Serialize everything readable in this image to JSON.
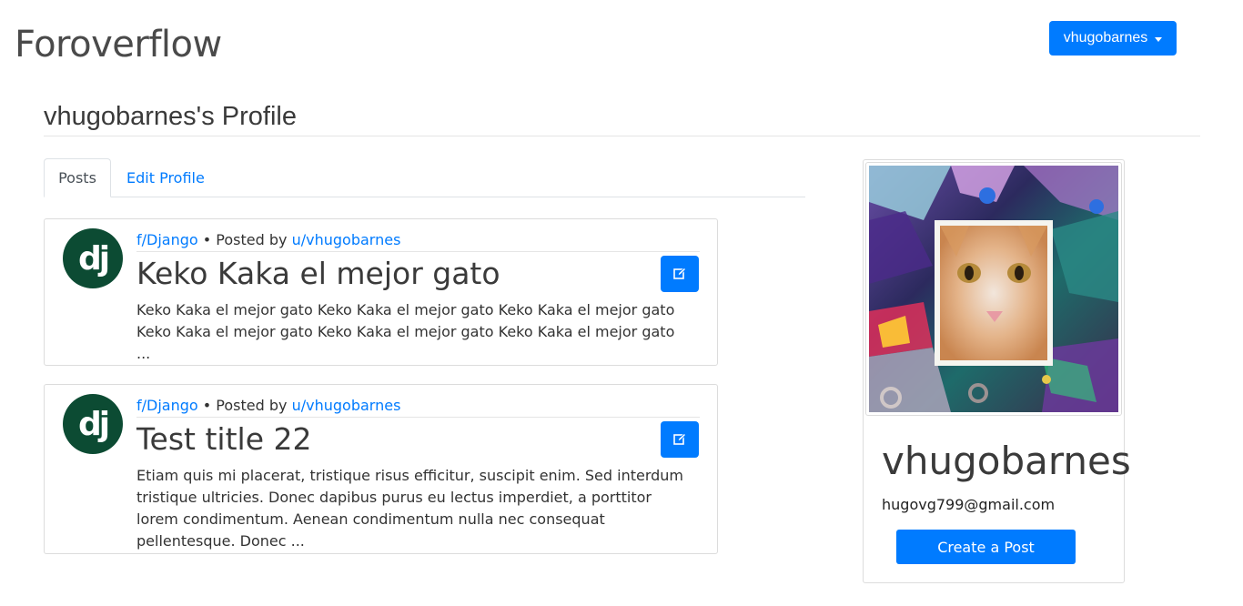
{
  "header": {
    "brand": "Foroverflow",
    "user_menu_label": "vhugobarnes"
  },
  "profile": {
    "title": "vhugobarnes's Profile"
  },
  "tabs": [
    {
      "label": "Posts",
      "active": true
    },
    {
      "label": "Edit Profile",
      "active": false
    }
  ],
  "posts": [
    {
      "logo_text": "dj",
      "forum": "f/Django",
      "posted_by_text": "• Posted by",
      "author": "u/vhugobarnes",
      "title": "Keko Kaka el mejor gato",
      "excerpt": "Keko Kaka el mejor gato Keko Kaka el mejor gato Keko Kaka el mejor gato Keko Kaka el mejor gato Keko Kaka el mejor gato Keko Kaka el mejor gato ..."
    },
    {
      "logo_text": "dj",
      "forum": "f/Django",
      "posted_by_text": "• Posted by",
      "author": "u/vhugobarnes",
      "title": "Test title 22",
      "excerpt": "Etiam quis mi placerat, tristique risus efficitur, suscipit enim. Sed interdum tristique ultricies. Donec dapibus purus eu lectus imperdiet, a porttitor lorem condimentum. Aenean condimentum nulla nec consequat pellentesque. Donec ..."
    }
  ],
  "sidebar": {
    "username": "vhugobarnes",
    "email": "hugovg799@gmail.com",
    "create_post_label": "Create a Post"
  },
  "colors": {
    "primary": "#007bff",
    "django_green": "#0c4b33"
  },
  "icons": {
    "edit": "edit-icon",
    "user_menu": "caret-down-icon"
  }
}
